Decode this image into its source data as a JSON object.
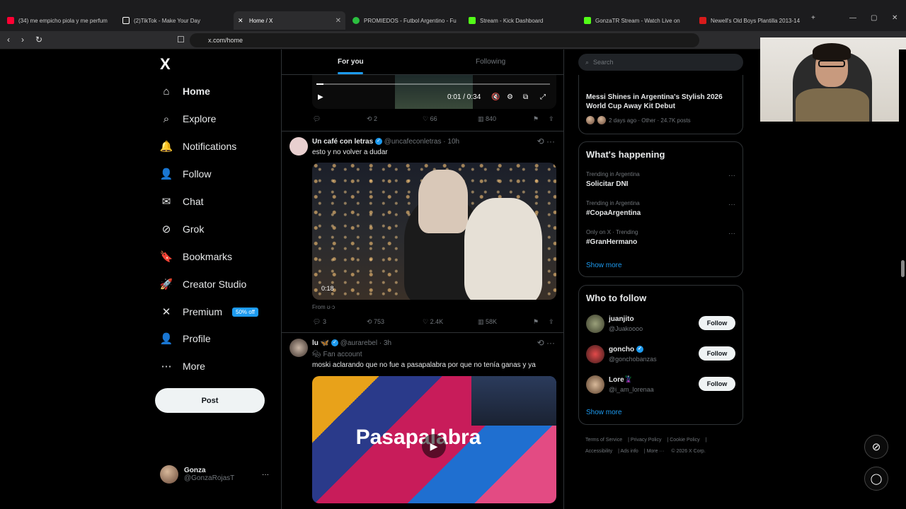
{
  "browser": {
    "tabs": [
      {
        "title": "(34) me empicho piola y me perfum",
        "color": "#ff0033"
      },
      {
        "title": "(2)TikTok - Make Your Day",
        "color": "#ffffff"
      },
      {
        "title": "Home / X",
        "color": "#ffffff"
      },
      {
        "title": "PROMIEDOS - Futbol Argentino - Fu",
        "color": "#2bbf3f"
      },
      {
        "title": "Stream - Kick Dashboard",
        "color": "#53fc18"
      },
      {
        "title": "GonzaTR Stream - Watch Live on",
        "color": "#53fc18"
      },
      {
        "title": "Newell's Old Boys Plantilla 2013-14",
        "color": "#d81b1b"
      }
    ],
    "url": "x.com/home"
  },
  "sidebar": {
    "logo": "X",
    "items": [
      {
        "label": "Home",
        "icon": "home-icon",
        "glyph": "⌂",
        "bold": true
      },
      {
        "label": "Explore",
        "icon": "search-icon",
        "glyph": "⌕"
      },
      {
        "label": "Notifications",
        "icon": "bell-icon",
        "glyph": "🔔"
      },
      {
        "label": "Follow",
        "icon": "add-person-icon",
        "glyph": "👤"
      },
      {
        "label": "Chat",
        "icon": "mail-icon",
        "glyph": "✉"
      },
      {
        "label": "Grok",
        "icon": "grok-icon",
        "glyph": "⊘"
      },
      {
        "label": "Bookmarks",
        "icon": "bookmark-icon",
        "glyph": "🔖"
      },
      {
        "label": "Creator Studio",
        "icon": "rocket-icon",
        "glyph": "🚀"
      },
      {
        "label": "Premium",
        "icon": "x-premium-icon",
        "glyph": "✕",
        "badge": "50% off"
      },
      {
        "label": "Profile",
        "icon": "person-icon",
        "glyph": "👤"
      },
      {
        "label": "More",
        "icon": "more-circle-icon",
        "glyph": "⋯"
      }
    ],
    "post_label": "Post",
    "user": {
      "name": "Gonza",
      "handle": "@GonzaRojasT"
    }
  },
  "feed": {
    "tabs": [
      "For you",
      "Following"
    ],
    "video_time": "0:01 / 0:34",
    "video_progress": 0.03,
    "top_actions": {
      "reposts": "2",
      "likes": "66",
      "views": "840"
    },
    "tweets": [
      {
        "name": "Un café con letras",
        "handle": "@uncafeconletras",
        "time": "10h",
        "text": "esto y no volver a dudar",
        "duration": "0:18",
        "from": "From ʊ·ɔ",
        "replies": "3",
        "reposts": "753",
        "likes": "2.4K",
        "views": "58K"
      },
      {
        "name": "lu 🦋",
        "handle": "@aurarebel",
        "time": "3h",
        "tag": "Fan account",
        "text": "moski aclarando que no fue a pasapalabra por que no tenía ganas y ya",
        "media_text": "Pasapalabra"
      }
    ]
  },
  "right": {
    "search_placeholder": "Search",
    "news": {
      "title": "Messi Shines in Argentina's Stylish 2026 World Cup Away Kit Debut",
      "meta": "2 days ago · Other · 24.7K posts"
    },
    "happening_title": "What's happening",
    "trends": [
      {
        "category": "Trending in Argentina",
        "name": "Solicitar DNI"
      },
      {
        "category": "Trending in Argentina",
        "name": "#CopaArgentina"
      },
      {
        "category": "Only on X · Trending",
        "name": "#GranHermano"
      }
    ],
    "show_more": "Show more",
    "wtf_title": "Who to follow",
    "wtf": [
      {
        "name": "juanjito",
        "handle": "@Juakoooo",
        "verified": false
      },
      {
        "name": "goncho",
        "handle": "@gonchobanzas",
        "verified": true
      },
      {
        "name": "Lore🦹",
        "handle": "@i_am_lorenaa",
        "verified": false
      }
    ],
    "follow_label": "Follow",
    "footer": [
      "Terms of Service",
      "Privacy Policy",
      "Cookie Policy",
      "Accessibility",
      "Ads info",
      "More ···",
      "© 2026 X Corp."
    ]
  }
}
